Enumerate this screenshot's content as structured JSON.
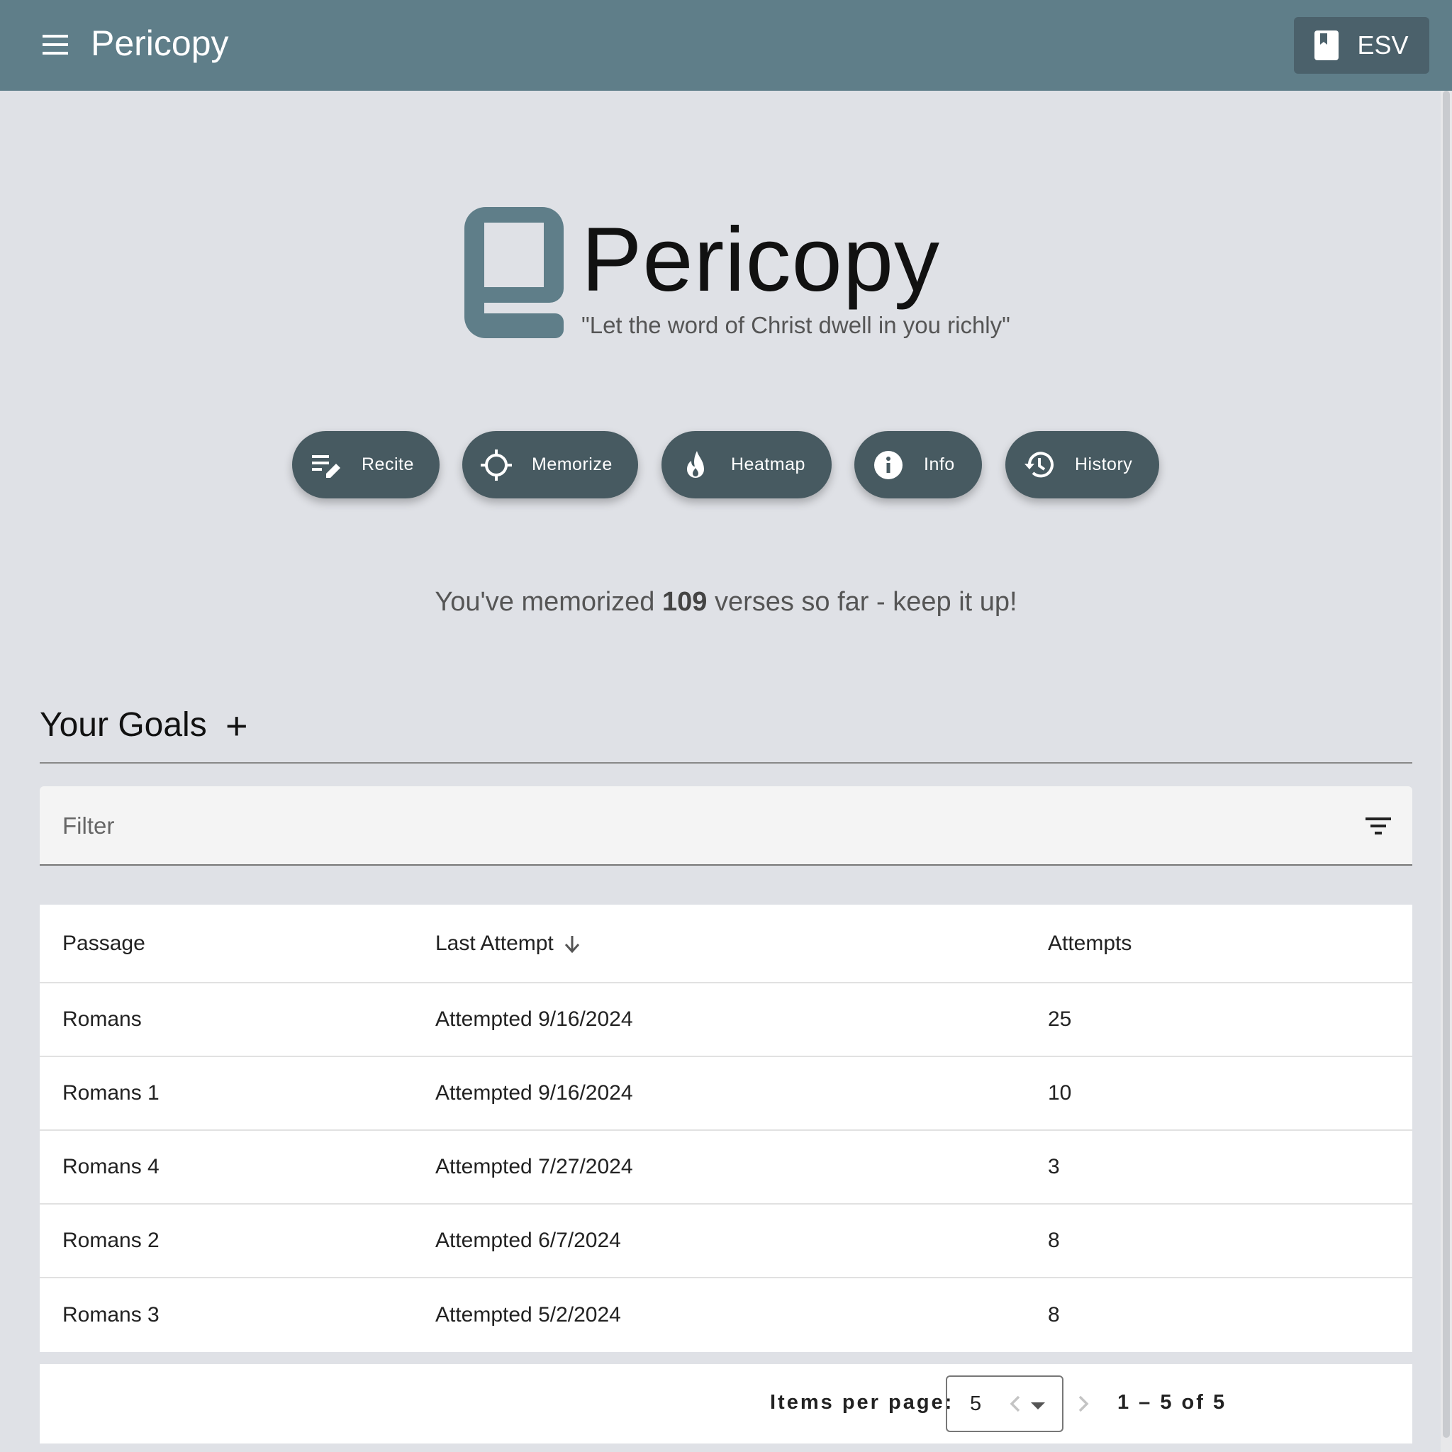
{
  "toolbar": {
    "title": "Pericopy",
    "translation_label": "ESV"
  },
  "hero": {
    "title": "Pericopy",
    "quote": "\"Let the word of Christ dwell in you richly\""
  },
  "actions": [
    {
      "label": "Recite",
      "icon": "edit-note-icon"
    },
    {
      "label": "Memorize",
      "icon": "crosshair-icon"
    },
    {
      "label": "Heatmap",
      "icon": "flame-icon"
    },
    {
      "label": "Info",
      "icon": "info-icon"
    },
    {
      "label": "History",
      "icon": "history-icon"
    }
  ],
  "memorized": {
    "prefix": "You've memorized ",
    "count": "109",
    "suffix": " verses so far - keep it up!"
  },
  "goals": {
    "title": "Your Goals",
    "add_label": "+",
    "filter_placeholder": "Filter",
    "columns": [
      "Passage",
      "Last Attempt",
      "Attempts"
    ],
    "rows": [
      {
        "passage": "Romans",
        "last_attempt": "Attempted 9/16/2024",
        "attempts": "25"
      },
      {
        "passage": "Romans 1",
        "last_attempt": "Attempted 9/16/2024",
        "attempts": "10"
      },
      {
        "passage": "Romans 4",
        "last_attempt": "Attempted 7/27/2024",
        "attempts": "3"
      },
      {
        "passage": "Romans 2",
        "last_attempt": "Attempted 6/7/2024",
        "attempts": "8"
      },
      {
        "passage": "Romans 3",
        "last_attempt": "Attempted 5/2/2024",
        "attempts": "8"
      }
    ]
  },
  "paginator": {
    "items_per_page_label": "Items per page:",
    "items_per_page_value": "5",
    "range_label": "1 – 5 of 5"
  },
  "colors": {
    "toolbar": "#5f7e89",
    "action_button": "#475a61",
    "background": "#dfe1e6"
  }
}
